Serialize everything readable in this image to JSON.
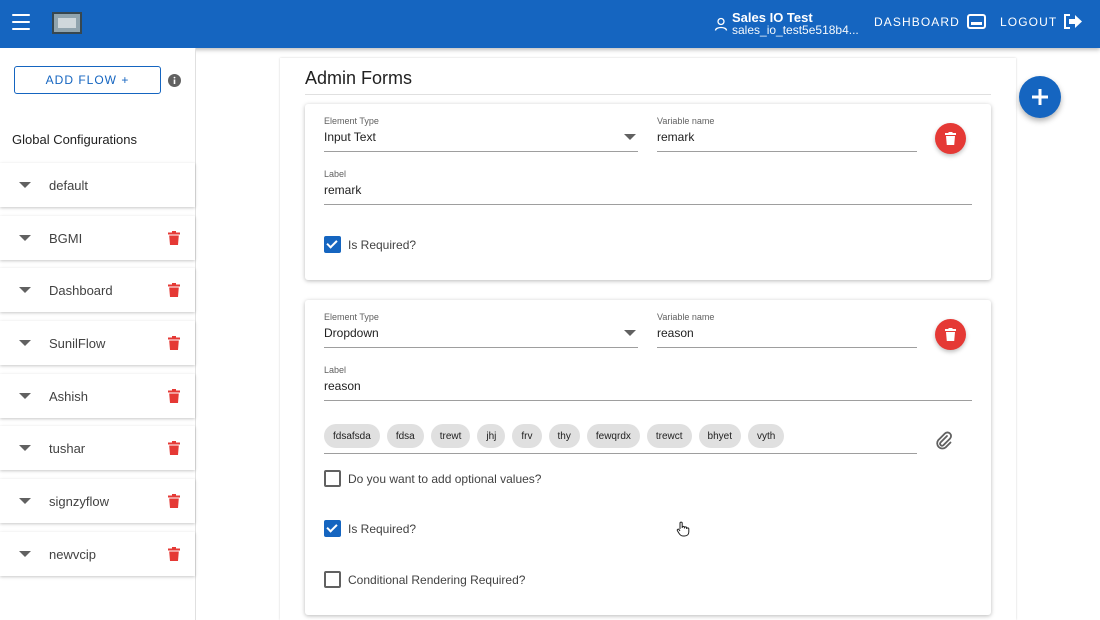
{
  "header": {
    "user_name": "Sales IO Test",
    "user_email": "sales_io_test5e518b4...",
    "dashboard_label": "DASHBOARD",
    "logout_label": "LOGOUT"
  },
  "sidebar": {
    "add_flow_label": "ADD FLOW +",
    "global_config_title": "Global Configurations",
    "flows": [
      {
        "label": "default",
        "deletable": false
      },
      {
        "label": "BGMI",
        "deletable": true
      },
      {
        "label": "Dashboard",
        "deletable": true
      },
      {
        "label": "SunilFlow",
        "deletable": true
      },
      {
        "label": "Ashish",
        "deletable": true
      },
      {
        "label": "tushar",
        "deletable": true
      },
      {
        "label": "signzyflow",
        "deletable": true
      },
      {
        "label": "newvcip",
        "deletable": true
      }
    ]
  },
  "main": {
    "title": "Admin Forms",
    "forms": [
      {
        "element_type_label": "Element Type",
        "element_type_value": "Input Text",
        "variable_name_label": "Variable name",
        "variable_name_value": "remark",
        "label_label": "Label",
        "label_value": "remark",
        "is_required_label": "Is Required?",
        "is_required": true
      },
      {
        "element_type_label": "Element Type",
        "element_type_value": "Dropdown",
        "variable_name_label": "Variable name",
        "variable_name_value": "reason",
        "label_label": "Label",
        "label_value": "reason",
        "options": [
          "fdsafsda",
          "fdsa",
          "trewt",
          "jhj",
          "frv",
          "thy",
          "fewqrdx",
          "trewct",
          "bhyet",
          "vyth"
        ],
        "optional_values_label": "Do you want to add optional values?",
        "optional_values": false,
        "is_required_label": "Is Required?",
        "is_required": true,
        "conditional_rendering_label": "Conditional Rendering Required?",
        "conditional_rendering": false
      }
    ]
  },
  "colors": {
    "primary": "#1565c0",
    "danger": "#e53935",
    "chip": "#e0e0e0"
  }
}
